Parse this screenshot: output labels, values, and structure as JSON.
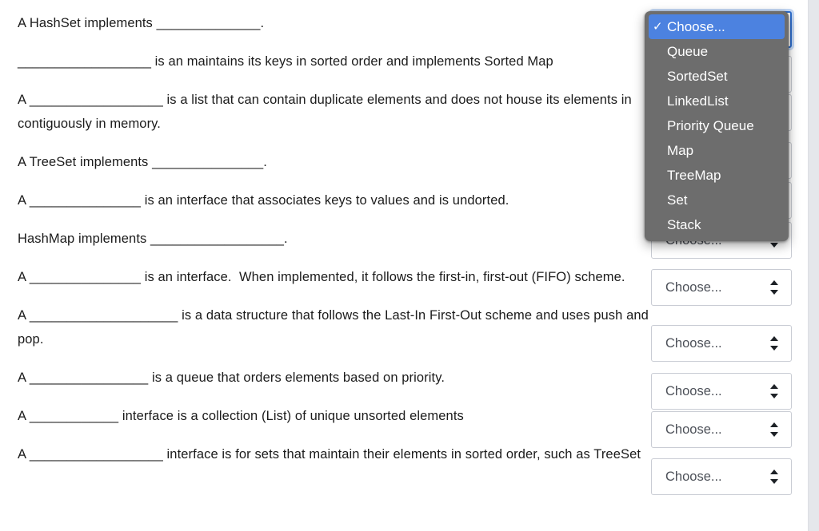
{
  "questions": [
    "A HashSet implements ______________.",
    "__________________ is an maintains its keys in sorted order and implements Sorted Map",
    "A __________________ is a list that can contain duplicate elements and does not house its elements in contiguously in memory.",
    "A TreeSet implements _______________.",
    "A _______________ is an interface that associates keys to values and is undorted.",
    "HashMap implements __________________.",
    "A _______________ is an interface.  When implemented, it follows the first-in, first-out (FIFO) scheme.",
    "A ____________________ is a data structure that follows the Last-In First-Out scheme and uses push and pop.",
    "A ________________ is a queue that orders elements based on priority.",
    "A ____________ interface is a collection (List) of unique unsorted elements",
    "A __________________ interface is for sets that maintain their elements in sorted order, such as TreeSet"
  ],
  "selects": [
    {
      "value": "Choose...",
      "focused": true
    },
    {
      "value": "Choose...",
      "focused": false
    },
    {
      "value": "Choose...",
      "focused": false
    },
    {
      "value": "Choose...",
      "focused": false
    },
    {
      "value": "Choose...",
      "focused": false
    },
    {
      "value": "Choose...",
      "focused": false
    },
    {
      "value": "Choose...",
      "focused": false
    },
    {
      "value": "Choose...",
      "focused": false
    },
    {
      "value": "Choose...",
      "focused": false
    },
    {
      "value": "Choose...",
      "focused": false
    },
    {
      "value": "Choose...",
      "focused": false
    }
  ],
  "dropdown": {
    "open": true,
    "selected_index": 0,
    "check_glyph": "✓",
    "options": [
      "Choose...",
      "Queue",
      "SortedSet",
      "LinkedList",
      "Priority Queue",
      "Map",
      "TreeMap",
      "Set",
      "Stack"
    ]
  },
  "colors": {
    "dropdown_background": "#6d6d6d",
    "dropdown_highlight": "#4c82e0",
    "select_border": "#c9ccd4",
    "focus_ring": "#2f6fd0",
    "text": "#1b1b1b",
    "placeholder_text": "#4d5159",
    "gutter": "#e5e7eb"
  }
}
